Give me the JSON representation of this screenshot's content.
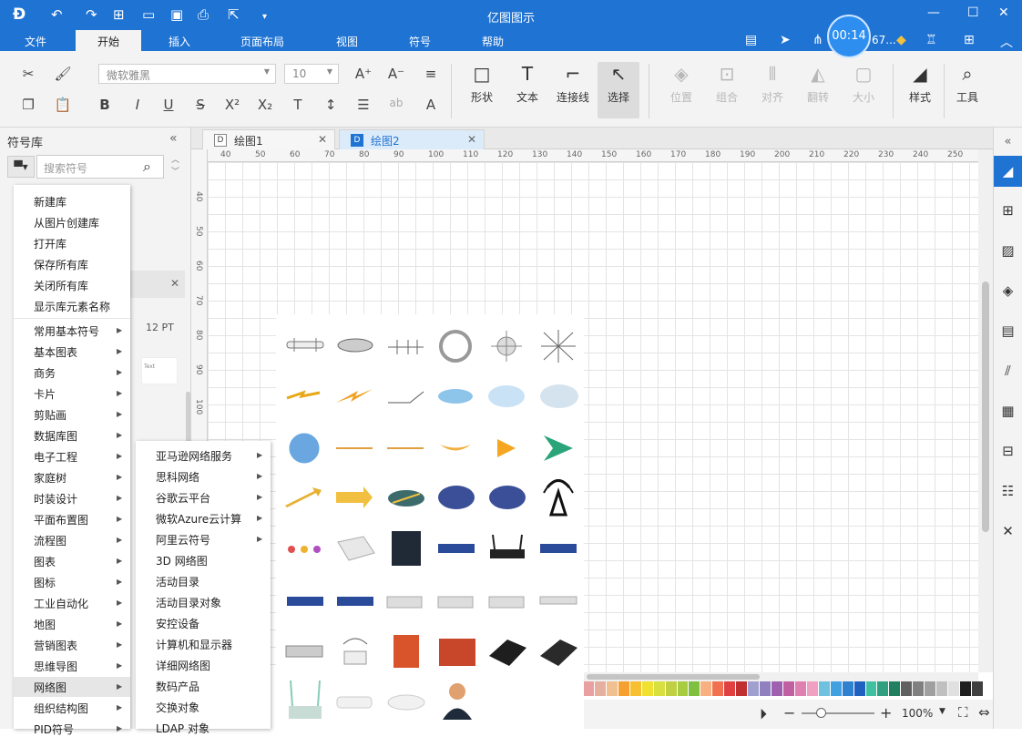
{
  "titlebar": {
    "title": "亿图图示",
    "timer": "00:14",
    "user": "67...",
    "buttons": {
      "minimize": "—",
      "maximize": "☐",
      "close": "✕"
    }
  },
  "menu_tabs": [
    "文件",
    "开始",
    "插入",
    "页面布局",
    "视图",
    "符号",
    "帮助"
  ],
  "active_menu_tab": "开始",
  "ribbon": {
    "font_family": "微软雅黑",
    "font_size": "10",
    "tools": [
      "形状",
      "文本",
      "连接线",
      "选择"
    ],
    "arrange": [
      "位置",
      "组合",
      "对齐",
      "翻转",
      "大小"
    ],
    "style": "样式",
    "tools_menu": "工具"
  },
  "library": {
    "title": "符号库",
    "search_placeholder": "搜索符号",
    "ghost_size": "12 PT",
    "ghost_text": "Text"
  },
  "library_menu": {
    "top_items": [
      "新建库",
      "从图片创建库",
      "打开库",
      "保存所有库",
      "关闭所有库",
      "显示库元素名称"
    ],
    "categories": [
      "常用基本符号",
      "基本图表",
      "商务",
      "卡片",
      "剪贴画",
      "数据库图",
      "电子工程",
      "家庭树",
      "时装设计",
      "平面布置图",
      "流程图",
      "图表",
      "图标",
      "工业自动化",
      "地图",
      "营销图表",
      "思维导图",
      "网络图",
      "组织结构图",
      "PID符号"
    ]
  },
  "network_submenu": {
    "items": [
      "亚马逊网络服务",
      "思科网络",
      "谷歌云平台",
      "微软Azure云计算",
      "阿里云符号",
      "3D 网络图",
      "活动目录",
      "活动目录对象",
      "安控设备",
      "计算机和显示器",
      "详细网络图",
      "数码产品",
      "交换对象",
      "LDAP 对象"
    ],
    "with_arrow": [
      true,
      true,
      true,
      true,
      true,
      false,
      false,
      false,
      false,
      false,
      false,
      false,
      false,
      false
    ]
  },
  "doc_tabs": [
    {
      "label": "绘图1",
      "active": false
    },
    {
      "label": "绘图2",
      "active": true
    }
  ],
  "hruler_labels": [
    "40",
    "50",
    "60",
    "70",
    "80",
    "90",
    "100",
    "110",
    "120",
    "130",
    "140",
    "150",
    "160",
    "170",
    "180",
    "190",
    "200",
    "210",
    "220",
    "230",
    "240",
    "250"
  ],
  "vruler_labels": [
    "40",
    "50",
    "60",
    "70",
    "80",
    "90",
    "100"
  ],
  "status": {
    "zoom": "100%"
  },
  "palette": [
    "#e8a0a0",
    "#e6b0a0",
    "#f0c090",
    "#f5a030",
    "#f7c030",
    "#f0e030",
    "#d8e040",
    "#c0d040",
    "#a8cc40",
    "#80c040",
    "#f8b080",
    "#f07050",
    "#e04040",
    "#c03030",
    "#a0a0d0",
    "#9080c0",
    "#a060b0",
    "#c060a0",
    "#e080b0",
    "#f0a0c0",
    "#70c0e0",
    "#40a0e0",
    "#3080d0",
    "#2060c0",
    "#40c0a0",
    "#30a080",
    "#208060",
    "#606060",
    "#808080",
    "#a0a0a0",
    "#c0c0c0",
    "#e0e0e0",
    "#202020",
    "#404040"
  ]
}
